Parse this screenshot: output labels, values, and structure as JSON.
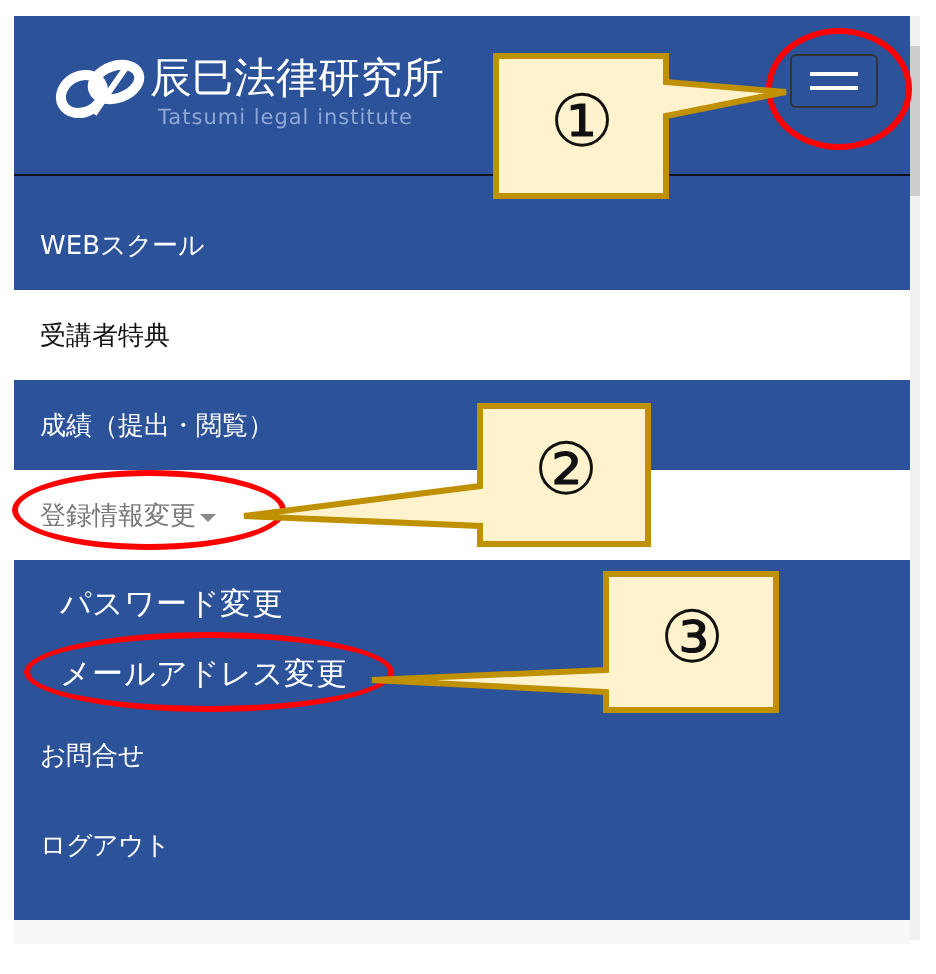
{
  "header": {
    "logo_title": "辰巳法律研究所",
    "logo_subtitle": "Tatsumi legal institute"
  },
  "menu": [
    {
      "kind": "link",
      "label": "WEBスクール",
      "highlighted": false
    },
    {
      "kind": "link",
      "label": "受講者特典",
      "highlighted": true
    },
    {
      "kind": "link",
      "label": "成績（提出・閲覧）",
      "highlighted": false
    },
    {
      "kind": "dropdown",
      "label": "登録情報変更",
      "highlighted": true,
      "expanded": true,
      "children": [
        {
          "label": "パスワード変更"
        },
        {
          "label": "メールアドレス変更"
        }
      ]
    },
    {
      "kind": "link",
      "label": "お問合せ",
      "highlighted": false
    },
    {
      "kind": "link",
      "label": "ログアウト",
      "highlighted": false
    }
  ],
  "annotations": [
    {
      "label": "①"
    },
    {
      "label": "②"
    },
    {
      "label": "③"
    }
  ]
}
